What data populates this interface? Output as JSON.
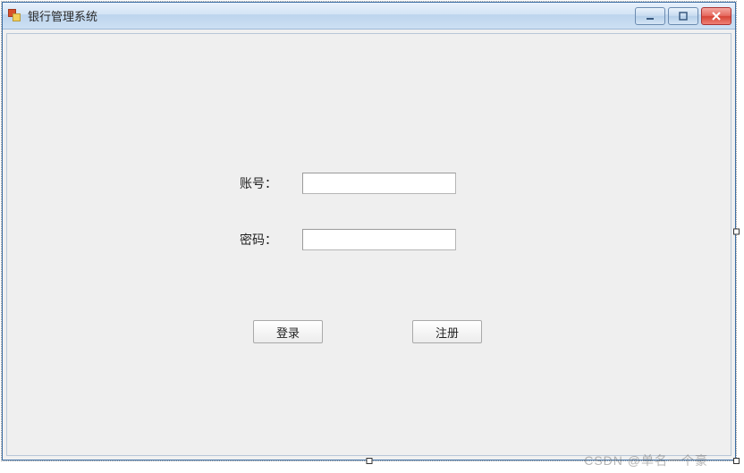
{
  "window": {
    "title": "银行管理系统"
  },
  "form": {
    "account_label": "账号：",
    "password_label": "密码：",
    "account_value": "",
    "password_value": ""
  },
  "buttons": {
    "login": "登录",
    "register": "注册"
  },
  "watermark": "CSDN @单名一个豪"
}
